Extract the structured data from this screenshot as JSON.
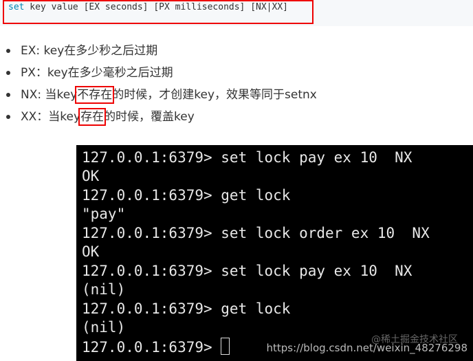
{
  "code": {
    "keyword": "set",
    "rest": " key value [EX seconds] [PX milliseconds] [NX|XX]"
  },
  "bullets": [
    {
      "pre": "EX: key在多少秒之后过期",
      "hl": "",
      "post": ""
    },
    {
      "pre": "PX：key在多少毫秒之后过期",
      "hl": "",
      "post": ""
    },
    {
      "pre": "NX: 当key",
      "hl": "不存在",
      "post": "的时候，才创建key，效果等同于setnx"
    },
    {
      "pre": "XX：当key",
      "hl": "存在",
      "post": "的时候，覆盖key"
    }
  ],
  "terminal": {
    "lines": [
      "127.0.0.1:6379> set lock pay ex 10  NX",
      "OK",
      "127.0.0.1:6379> get lock",
      "\"pay\"",
      "127.0.0.1:6379> set lock order ex 10  NX",
      "OK",
      "127.0.0.1:6379> set lock pay ex 10  NX",
      "(nil)",
      "127.0.0.1:6379> get lock",
      "(nil)",
      "127.0.0.1:6379> "
    ],
    "watermark": "https://blog.csdn.net/weixin_48276298",
    "watermark2": "@稀土掘金技术社区"
  }
}
